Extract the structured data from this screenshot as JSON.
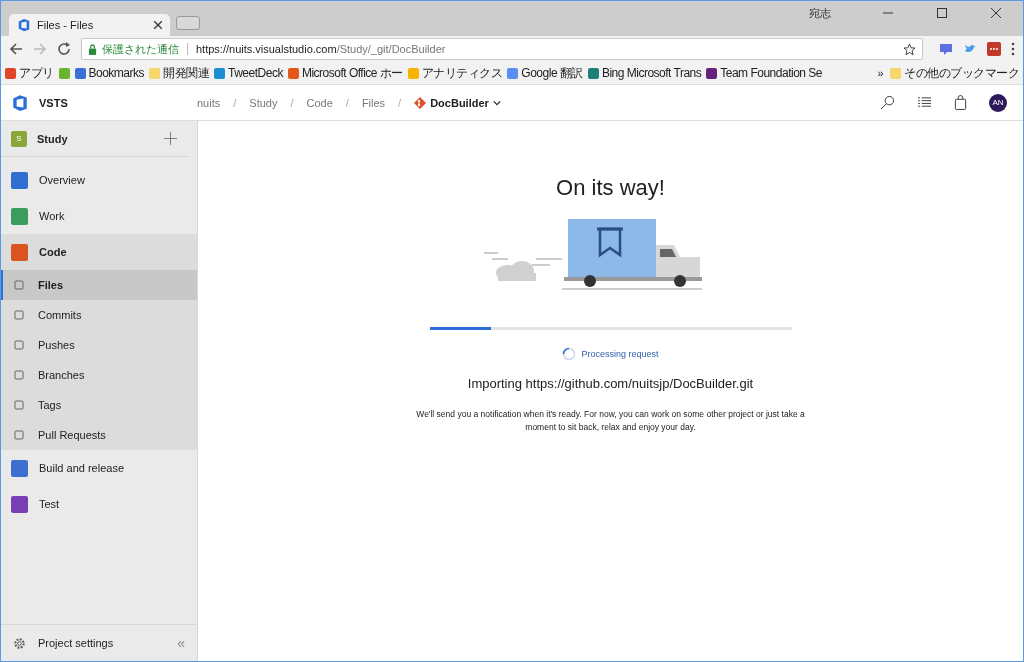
{
  "browser": {
    "tab_title": "Files - Files",
    "user": "宛志",
    "security_label": "保護された通信",
    "url_host": "https://nuits.visualstudio.com",
    "url_path": "/Study/_git/DocBuilder",
    "bookmarks": [
      {
        "label": "アプリ",
        "color": "#e0452c"
      },
      {
        "color": "#6ab42d"
      },
      {
        "label": "Bookmarks",
        "color": "#3b6fd8"
      },
      {
        "label": "開発関連",
        "color": "#f5d76e"
      },
      {
        "label": "TweetDeck",
        "color": "#1d8ed1"
      },
      {
        "label": "Microsoft Office ホー",
        "color": "#e3571a"
      },
      {
        "label": "アナリティクス",
        "color": "#f4b400"
      },
      {
        "label": "Google 翻訳",
        "color": "#5a8ef0"
      },
      {
        "label": "Bing Microsoft Trans",
        "color": "#1f7f7a"
      },
      {
        "label": "Team Foundation Se",
        "color": "#68217a"
      }
    ],
    "overflow": "»",
    "other_bookmarks": "その他のブックマーク"
  },
  "header": {
    "product": "VSTS",
    "separator": "/",
    "breadcrumb": [
      "nuits",
      "Study",
      "Code",
      "Files"
    ],
    "repo": "DocBuilder",
    "avatar": "AN"
  },
  "sidebar": {
    "project": {
      "initial": "S",
      "name": "Study"
    },
    "items": [
      {
        "label": "Overview",
        "selected": false,
        "expanded": false,
        "color": "#2f6fcf"
      },
      {
        "label": "Work",
        "selected": false,
        "expanded": false,
        "color": "#3a9d5d"
      },
      {
        "label": "Code",
        "selected": false,
        "expanded": true,
        "color": "#d9541e",
        "children": [
          {
            "label": "Files",
            "selected": true
          },
          {
            "label": "Commits",
            "selected": false
          },
          {
            "label": "Pushes",
            "selected": false
          },
          {
            "label": "Branches",
            "selected": false
          },
          {
            "label": "Tags",
            "selected": false
          },
          {
            "label": "Pull Requests",
            "selected": false
          }
        ]
      },
      {
        "label": "Build and release",
        "selected": false,
        "expanded": false,
        "color": "#3d6fd1"
      },
      {
        "label": "Test",
        "selected": false,
        "expanded": false,
        "color": "#7a3fb5"
      }
    ],
    "settings": "Project settings",
    "collapse": "«"
  },
  "main": {
    "title": "On its way!",
    "progress": {
      "level": 0.17
    },
    "status": "Processing request",
    "importing": "Importing https://github.com/nuitsjp/DocBuilder.git",
    "message": "We'll send you a notification when it's ready. For now, you can work on some other project or just take a moment to sit back, relax and enjoy your day."
  }
}
